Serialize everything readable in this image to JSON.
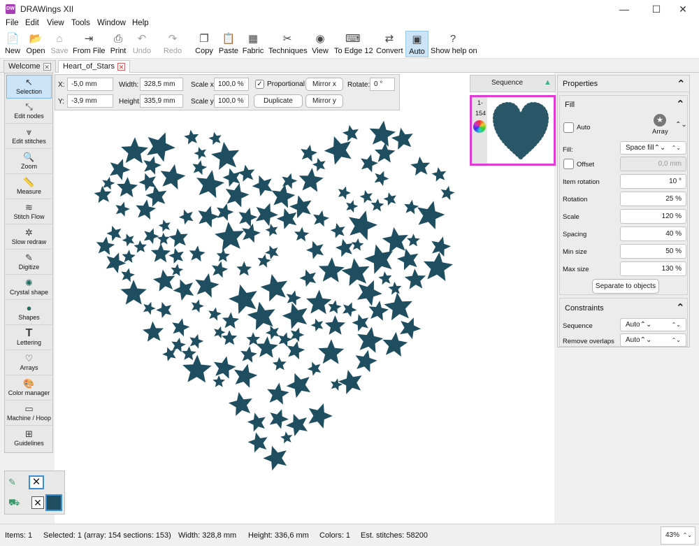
{
  "window": {
    "title": "DRAWings XII",
    "icon_label": "DW",
    "minimize": "—",
    "maximize": "☐",
    "close": "✕"
  },
  "menu": [
    "File",
    "Edit",
    "View",
    "Tools",
    "Window",
    "Help"
  ],
  "toolbar": [
    {
      "label": "New",
      "icon": "new-icon",
      "glyph": "📄"
    },
    {
      "label": "Open",
      "icon": "open-icon",
      "glyph": "📂"
    },
    {
      "label": "Save",
      "icon": "save-icon",
      "glyph": "⌂"
    },
    {
      "label": "From File",
      "icon": "from-file-icon",
      "glyph": "⇥"
    },
    {
      "label": "Print",
      "icon": "print-icon",
      "glyph": "⎙"
    },
    {
      "label": "Undo",
      "icon": "undo-icon",
      "glyph": "↶"
    },
    {
      "label": "Redo",
      "icon": "redo-icon",
      "glyph": "↷"
    },
    {
      "label": "Copy",
      "icon": "copy-icon",
      "glyph": "❐"
    },
    {
      "label": "Paste",
      "icon": "paste-icon",
      "glyph": "📋"
    },
    {
      "label": "Fabric",
      "icon": "fabric-icon",
      "glyph": "▦"
    },
    {
      "label": "Techniques",
      "icon": "techniques-icon",
      "glyph": "✂"
    },
    {
      "label": "View",
      "icon": "view-icon",
      "glyph": "◉"
    },
    {
      "label": "To Edge 12",
      "icon": "to-edge-icon",
      "glyph": "⌨"
    },
    {
      "label": "Convert",
      "icon": "convert-icon",
      "glyph": "⇄"
    },
    {
      "label": "Auto",
      "icon": "auto-icon",
      "glyph": "▣"
    },
    {
      "label": "Show help on",
      "icon": "help-icon",
      "glyph": "?"
    }
  ],
  "tabs": [
    {
      "label": "Welcome",
      "close": "✕"
    },
    {
      "label": "Heart_of_Stars",
      "close": "✕"
    }
  ],
  "tools": [
    {
      "label": "Selection",
      "icon": "selection-icon",
      "glyph": "↖"
    },
    {
      "label": "Edit nodes",
      "icon": "edit-nodes-icon",
      "glyph": "⤡"
    },
    {
      "label": "Edit stitches",
      "icon": "edit-stitches-icon",
      "glyph": "⩔"
    },
    {
      "label": "Zoom",
      "icon": "zoom-icon",
      "glyph": "🔍"
    },
    {
      "label": "Measure",
      "icon": "measure-icon",
      "glyph": "📏"
    },
    {
      "label": "Stitch Flow",
      "icon": "stitch-flow-icon",
      "glyph": "≋"
    },
    {
      "label": "Slow redraw",
      "icon": "slow-redraw-icon",
      "glyph": "✲"
    },
    {
      "label": "Digitize",
      "icon": "digitize-icon",
      "glyph": "✎"
    },
    {
      "label": "Crystal shape",
      "icon": "crystal-shape-icon",
      "glyph": "✺"
    },
    {
      "label": "Shapes",
      "icon": "shapes-icon",
      "glyph": "●"
    },
    {
      "label": "Lettering",
      "icon": "lettering-icon",
      "glyph": "T"
    },
    {
      "label": "Arrays",
      "icon": "arrays-icon",
      "glyph": "♡"
    },
    {
      "label": "Color manager",
      "icon": "color-manager-icon",
      "glyph": "🎨"
    },
    {
      "label": "Machine / Hoop",
      "icon": "machine-hoop-icon",
      "glyph": "▭"
    },
    {
      "label": "Guidelines",
      "icon": "guidelines-icon",
      "glyph": "⊞"
    }
  ],
  "selection_props": {
    "x_label": "X:",
    "x_value": "-5,0 mm",
    "y_label": "Y:",
    "y_value": "-3,9 mm",
    "width_label": "Width:",
    "width_value": "328,5 mm",
    "height_label": "Height:",
    "height_value": "335,9 mm",
    "scale_x_label": "Scale x:",
    "scale_x_value": "100,0 %",
    "scale_y_label": "Scale y:",
    "scale_y_value": "100,0 %",
    "proportional_label": "Proportional",
    "proportional_checked": true,
    "check_glyph": "✓",
    "duplicate_label": "Duplicate",
    "mirror_x_label": "Mirror x",
    "mirror_y_label": "Mirror y",
    "rotate_label": "Rotate:",
    "rotate_value": "0 °"
  },
  "sequence": {
    "title": "Sequence",
    "item_range_start": "1-",
    "item_range_end": "154",
    "collapse": "▲"
  },
  "properties": {
    "title": "Properties",
    "collapse": "⌃",
    "fill": {
      "header": "Fill",
      "auto_label": "Auto",
      "array_label": "Array",
      "fill_label": "Fill:",
      "fill_value": "Space fill",
      "offset_label": "Offset",
      "offset_value": "0,0 mm",
      "rows": [
        {
          "label": "Item rotation",
          "value": "10 °"
        },
        {
          "label": "Rotation",
          "value": "25 %"
        },
        {
          "label": "Scale",
          "value": "120 %"
        },
        {
          "label": "Spacing",
          "value": "40 %"
        },
        {
          "label": "Min size",
          "value": "50 %"
        },
        {
          "label": "Max size",
          "value": "130 %"
        }
      ],
      "separate_button": "Separate to objects"
    },
    "constraints": {
      "header": "Constraints",
      "sequence_label": "Sequence",
      "sequence_value": "Auto",
      "remove_overlaps_label": "Remove overlaps",
      "remove_overlaps_value": "Auto"
    }
  },
  "colors": {
    "accent": "#1e4e5f",
    "highlight": "#e23ad6",
    "select": "#cce4f7"
  },
  "status": {
    "items": "Items: 1",
    "selected": "Selected: 1 (array: 154  sections: 153)",
    "width": "Width: 328,8 mm",
    "height": "Height: 336,6 mm",
    "colors": "Colors: 1",
    "stitches": "Est. stitches: 58200",
    "zoom": "43%",
    "zoom_arrows": "⌃⌄"
  }
}
